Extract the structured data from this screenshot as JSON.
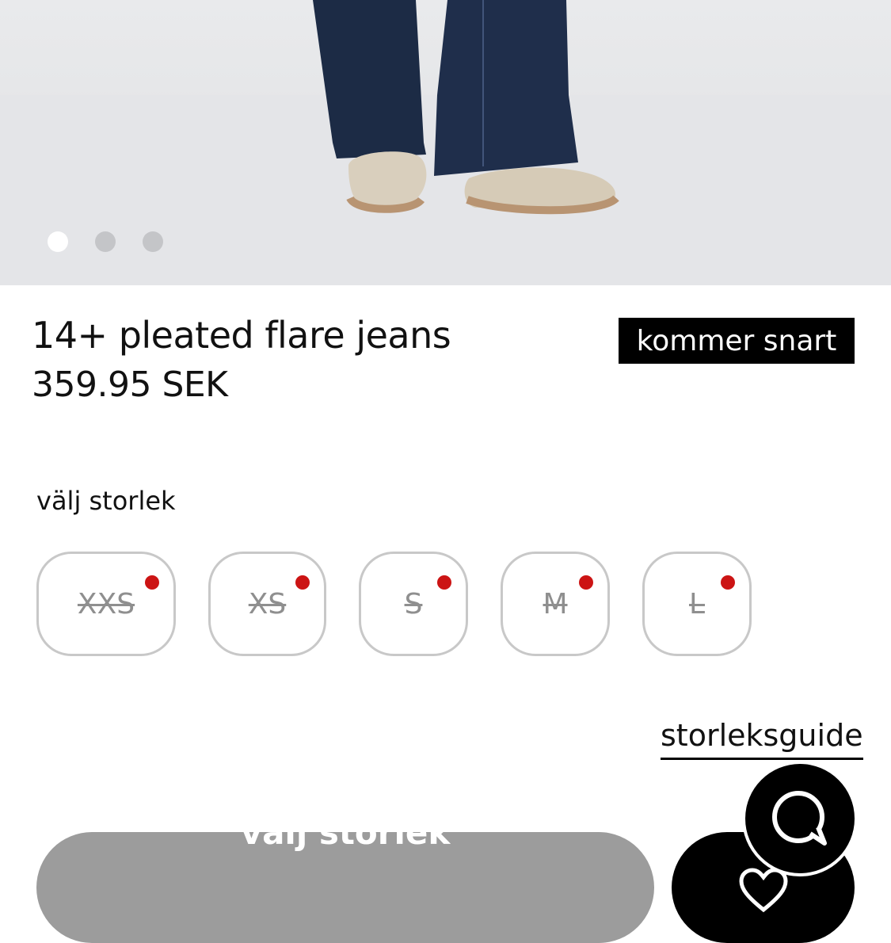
{
  "carousel": {
    "dot_count": 3,
    "active_index": 0
  },
  "product": {
    "title": "14+ pleated flare jeans",
    "price": "359.95 SEK",
    "badge": "kommer snart"
  },
  "size_selector": {
    "label": "välj storlek",
    "sizes": [
      {
        "label": "XXS",
        "available": false,
        "notify": true
      },
      {
        "label": "XS",
        "available": false,
        "notify": true
      },
      {
        "label": "S",
        "available": false,
        "notify": true
      },
      {
        "label": "M",
        "available": false,
        "notify": true
      },
      {
        "label": "L",
        "available": false,
        "notify": true
      }
    ],
    "guide_link": "storleksguide"
  },
  "actions": {
    "add_button": "välj storlek",
    "favorite_icon": "heart-icon",
    "chat_icon": "chat-bubble-icon"
  },
  "colors": {
    "notify_dot": "#cc1414",
    "badge_bg": "#000000",
    "add_button_bg": "#9c9c9c"
  }
}
